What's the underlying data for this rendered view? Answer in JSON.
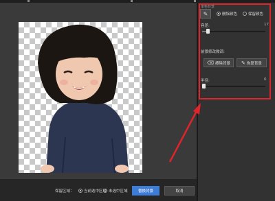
{
  "panel": {
    "title": "单色背景",
    "options": [
      {
        "label": "删除颜色",
        "selected": true
      },
      {
        "label": "保留颜色",
        "selected": false
      }
    ],
    "tolerance": {
      "label": "容差:",
      "value": "17"
    },
    "section_title": "前景修改微调:",
    "tools": [
      {
        "icon": "eraser-icon",
        "label": "擦除背景"
      },
      {
        "icon": "brush-icon",
        "label": "恢复背景"
      }
    ],
    "radius": {
      "label": "半径:",
      "value": "0"
    }
  },
  "bottom": {
    "label": "保留区域：",
    "options": [
      {
        "label": "当前选中区域",
        "selected": true
      },
      {
        "label": "未选中区域",
        "selected": false
      }
    ],
    "confirm": "替换背景",
    "cancel": "取消"
  },
  "colors": {
    "accent": "#3d7dd8",
    "highlight": "#e0242b"
  }
}
